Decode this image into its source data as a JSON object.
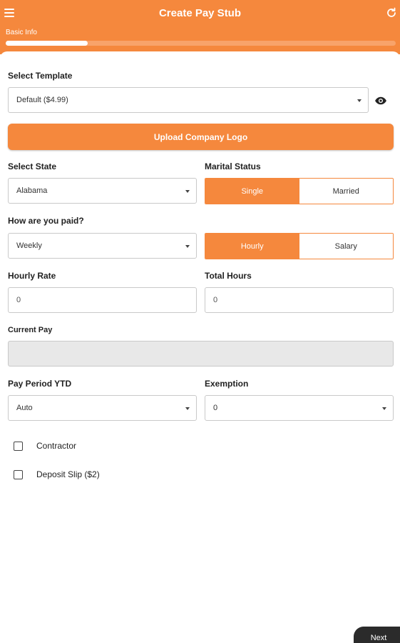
{
  "header": {
    "title": "Create Pay Stub",
    "step_label": "Basic Info",
    "progress_fraction": 0.21,
    "accent_color": "#f5883d",
    "menu_icon": "hamburger-icon",
    "refresh_icon": "refresh-icon"
  },
  "template": {
    "label": "Select Template",
    "value": "Default ($4.99)",
    "preview_icon": "eye-icon"
  },
  "upload_logo": {
    "label": "Upload Company Logo"
  },
  "state": {
    "label": "Select State",
    "value": "Alabama"
  },
  "marital": {
    "label": "Marital Status",
    "options": [
      "Single",
      "Married"
    ],
    "selected": "Single"
  },
  "pay_frequency": {
    "label": "How are you paid?",
    "value": "Weekly"
  },
  "pay_type": {
    "options": [
      "Hourly",
      "Salary"
    ],
    "selected": "Hourly"
  },
  "hourly_rate": {
    "label": "Hourly Rate",
    "placeholder": "0"
  },
  "total_hours": {
    "label": "Total Hours",
    "placeholder": "0"
  },
  "current_pay": {
    "label": "Current Pay",
    "value": ""
  },
  "pay_period_ytd": {
    "label": "Pay Period YTD",
    "value": "Auto"
  },
  "exemption": {
    "label": "Exemption",
    "value": "0"
  },
  "checkboxes": {
    "contractor": {
      "label": "Contractor",
      "checked": false
    },
    "deposit_slip": {
      "label": "Deposit Slip ($2)",
      "checked": false
    }
  },
  "footer": {
    "next_label": "Next"
  }
}
